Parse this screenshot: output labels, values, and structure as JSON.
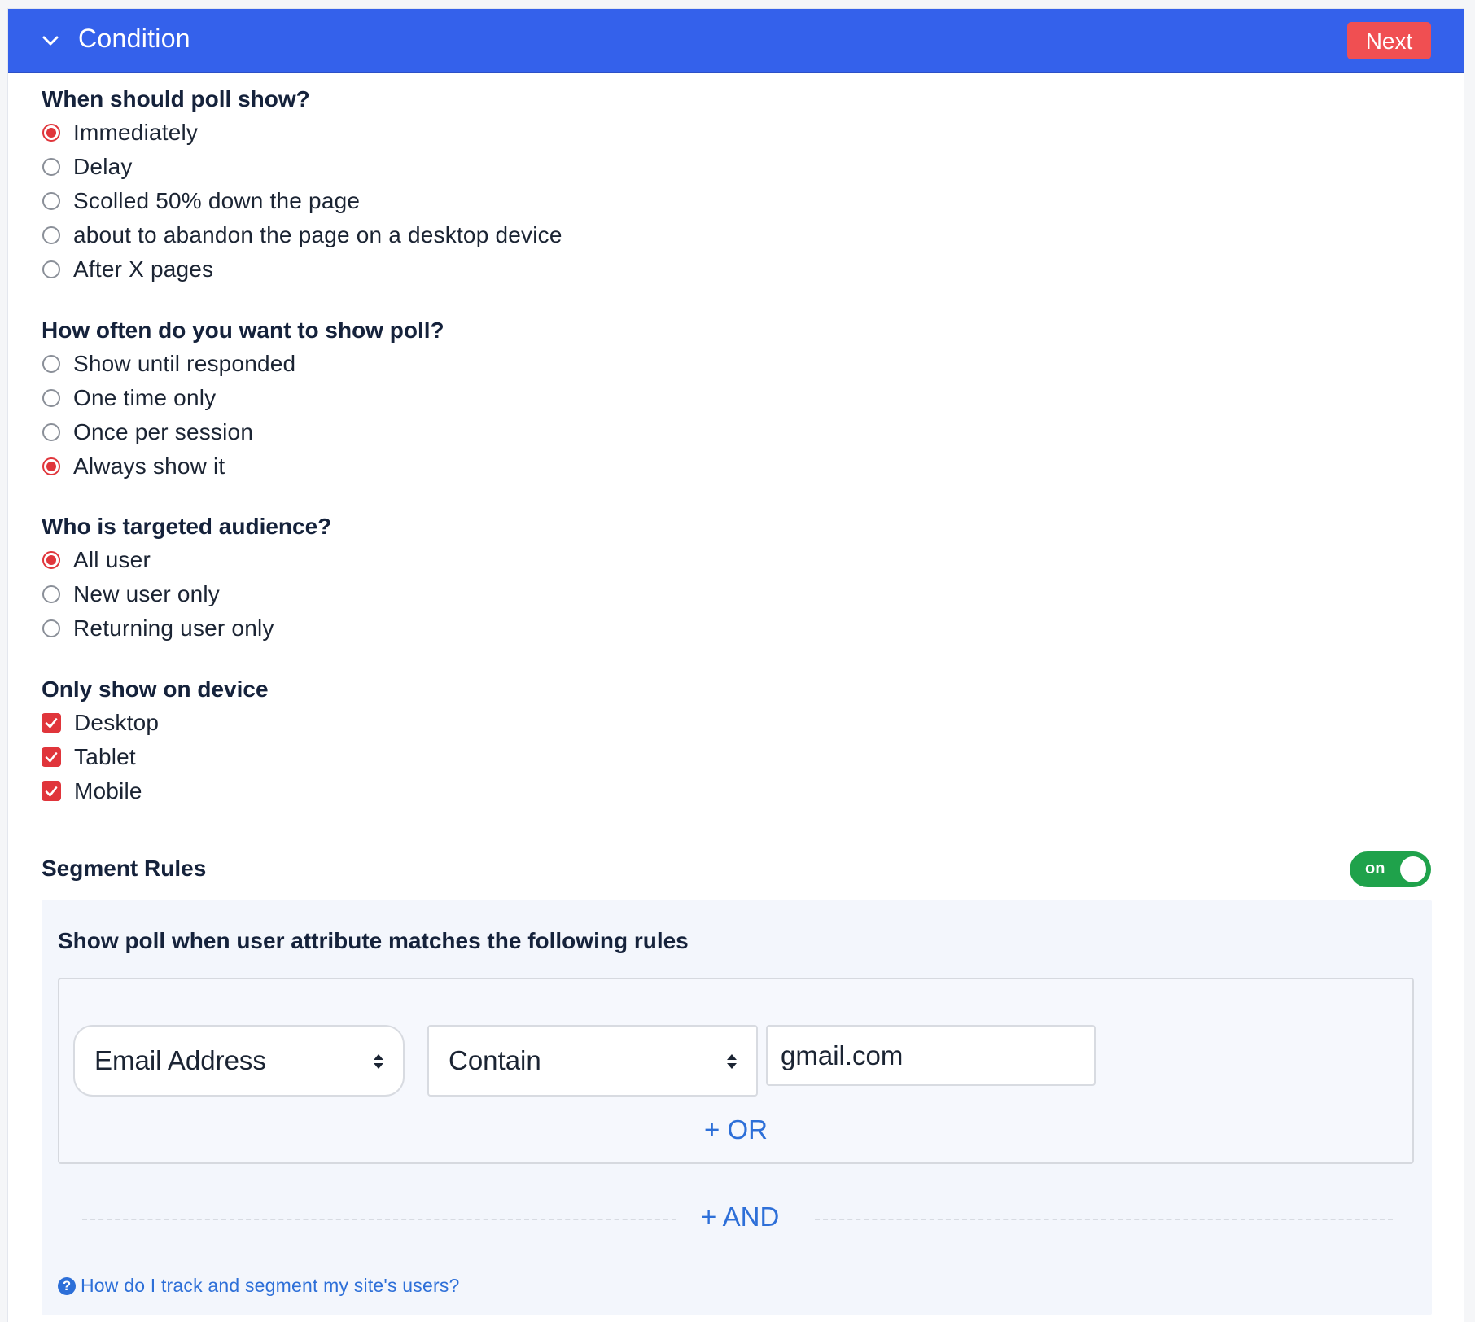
{
  "header": {
    "title": "Condition",
    "next_label": "Next"
  },
  "when_section": {
    "title": "When should poll show?",
    "options": [
      {
        "label": "Immediately",
        "checked": true
      },
      {
        "label": "Delay",
        "checked": false
      },
      {
        "label": "Scolled 50% down the page",
        "checked": false
      },
      {
        "label": "about to abandon the page on a desktop device",
        "checked": false
      },
      {
        "label": "After X pages",
        "checked": false
      }
    ]
  },
  "frequency_section": {
    "title": "How often do you want to show poll?",
    "options": [
      {
        "label": "Show until responded",
        "checked": false
      },
      {
        "label": "One time only",
        "checked": false
      },
      {
        "label": "Once per session",
        "checked": false
      },
      {
        "label": "Always show it",
        "checked": true
      }
    ]
  },
  "audience_section": {
    "title": "Who is targeted audience?",
    "options": [
      {
        "label": "All user",
        "checked": true
      },
      {
        "label": "New user only",
        "checked": false
      },
      {
        "label": "Returning user only",
        "checked": false
      }
    ]
  },
  "device_section": {
    "title": "Only show on device",
    "options": [
      {
        "label": "Desktop",
        "checked": true
      },
      {
        "label": "Tablet",
        "checked": true
      },
      {
        "label": "Mobile",
        "checked": true
      }
    ]
  },
  "segment": {
    "title": "Segment Rules",
    "toggle_label": "on",
    "toggle_on": true,
    "heading": "Show poll when user attribute matches the following rules",
    "rule": {
      "attribute": "Email Address",
      "operator": "Contain",
      "value": "gmail.com"
    },
    "or_label": "+ OR",
    "and_label": "+ AND",
    "help_text": "How do I track and segment my site's users?"
  },
  "colors": {
    "header_bg": "#3461eb",
    "next_button": "#f04f52",
    "checked_red": "#e0353b",
    "toggle_green": "#1fa24b",
    "link_blue": "#2d6fd8"
  }
}
